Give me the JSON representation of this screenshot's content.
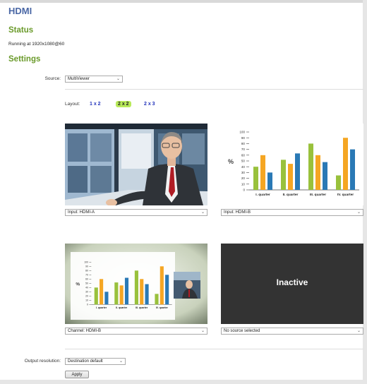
{
  "page": {
    "title": "HDMI",
    "status_heading": "Status",
    "status_text": "Running at 1920x1080@60",
    "settings_heading": "Settings"
  },
  "source": {
    "label": "Source:",
    "value": "MultiViewer"
  },
  "layout": {
    "label": "Layout:",
    "options": [
      "1 x 2",
      "2 x 2",
      "2 x 3"
    ],
    "selected": "2 x 2"
  },
  "tiles": [
    {
      "select_value": "Input: HDMI-A"
    },
    {
      "select_value": "Input: HDMI-B"
    },
    {
      "select_value": "Channel: HDMI-B"
    },
    {
      "select_value": "No source selected",
      "overlay_text": "Inactive"
    }
  ],
  "output_resolution": {
    "label": "Output resolution:",
    "value": "Destination default"
  },
  "apply_label": "Apply",
  "colors": {
    "title": "#4a67a5",
    "section": "#6a9a2a",
    "layout_active": "#b8ea5a",
    "layout_link": "#2233bb"
  },
  "chart_data": {
    "type": "bar",
    "categories": [
      "I. quarter",
      "II. quarter",
      "III. quarter",
      "IV. quarter"
    ],
    "series": [
      {
        "values": [
          40,
          52,
          80,
          25
        ]
      },
      {
        "values": [
          60,
          45,
          60,
          90
        ]
      },
      {
        "values": [
          30,
          63,
          48,
          70
        ]
      }
    ],
    "series_colors": [
      "#99c13c",
      "#f5a623",
      "#2a79b5"
    ],
    "ylabel": "%",
    "ylim": [
      0,
      100
    ],
    "yticks": [
      0,
      10,
      20,
      30,
      40,
      50,
      60,
      70,
      80,
      90,
      100
    ]
  }
}
